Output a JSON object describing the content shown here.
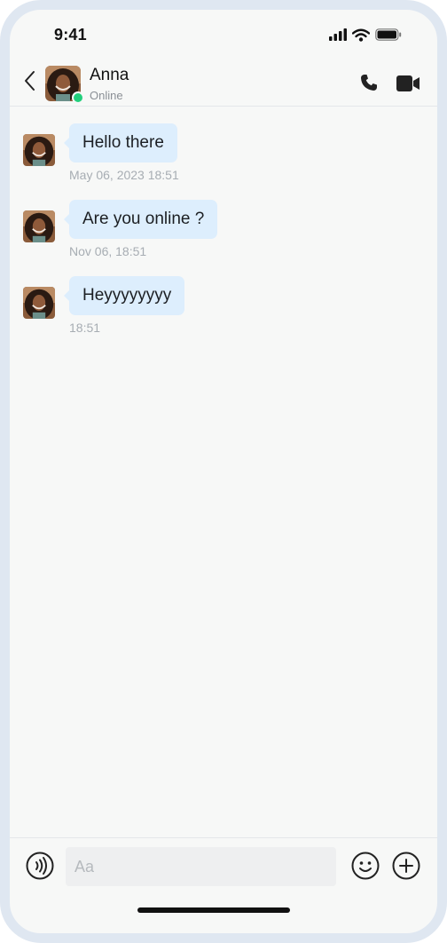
{
  "status_bar": {
    "time": "9:41"
  },
  "header": {
    "name": "Anna",
    "status": "Online"
  },
  "messages": [
    {
      "text": "Hello there",
      "time": "May 06, 2023 18:51"
    },
    {
      "text": "Are you online ?",
      "time": "Nov 06, 18:51"
    },
    {
      "text": "Heyyyyyyyy",
      "time": "18:51"
    }
  ],
  "composer": {
    "placeholder": "Aa"
  },
  "colors": {
    "online": "#22cf7c",
    "bubble": "#ddeefd",
    "frame": "#dfe7f1"
  }
}
